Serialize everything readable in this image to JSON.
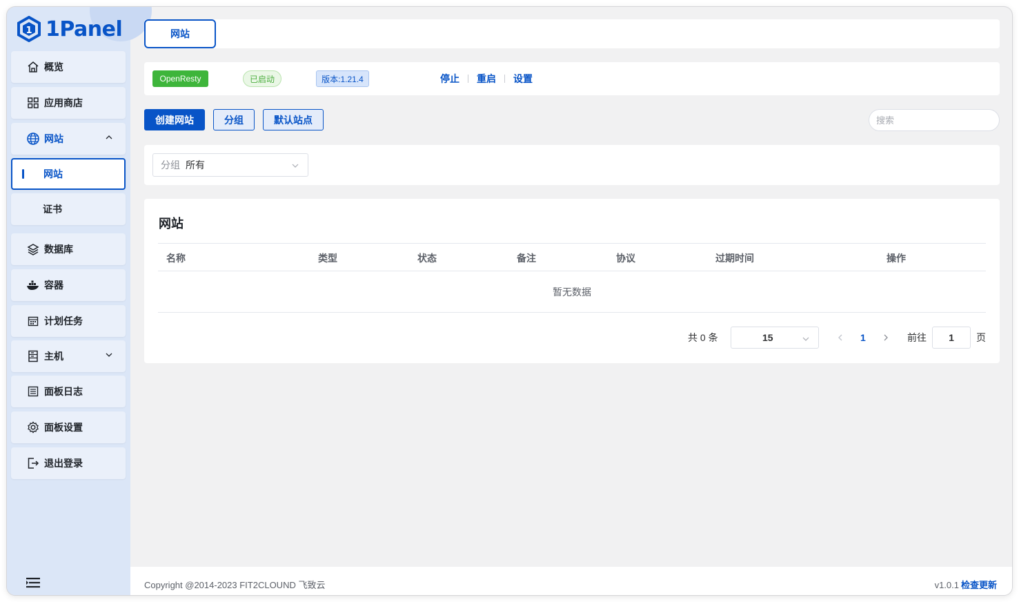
{
  "app": {
    "logo_text": "1Panel"
  },
  "sidebar": {
    "items": [
      {
        "label": "概览",
        "icon": "home-icon"
      },
      {
        "label": "应用商店",
        "icon": "grid-icon"
      },
      {
        "label": "网站",
        "icon": "globe-icon",
        "expanded": true
      },
      {
        "label": "网站",
        "active": true
      },
      {
        "label": "证书"
      },
      {
        "label": "数据库",
        "icon": "layers-icon"
      },
      {
        "label": "容器",
        "icon": "docker-icon"
      },
      {
        "label": "计划任务",
        "icon": "calendar-icon"
      },
      {
        "label": "主机",
        "icon": "server-icon"
      },
      {
        "label": "面板日志",
        "icon": "log-icon"
      },
      {
        "label": "面板设置",
        "icon": "gear-icon"
      },
      {
        "label": "退出登录",
        "icon": "logout-icon"
      }
    ]
  },
  "tabs": {
    "active": "网站"
  },
  "app_status": {
    "name": "OpenResty",
    "status": "已启动",
    "version": "版本:1.21.4",
    "actions": [
      "停止",
      "重启",
      "设置"
    ]
  },
  "toolbar": {
    "create": "创建网站",
    "group": "分组",
    "default_site": "默认站点",
    "search_placeholder": "搜索"
  },
  "filter": {
    "label": "分组",
    "value": "所有"
  },
  "table": {
    "title": "网站",
    "columns": [
      "名称",
      "类型",
      "状态",
      "备注",
      "协议",
      "过期时间",
      "操作"
    ],
    "empty_text": "暂无数据"
  },
  "pagination": {
    "total": "共 0 条",
    "page_size": "15",
    "current_page": "1",
    "goto_label": "前往",
    "goto_value": "1",
    "unit": "页"
  },
  "footer": {
    "copyright": "Copyright @2014-2023 FIT2CLOUND 飞致云",
    "version": "v1.0.1",
    "check_update": "检查更新"
  },
  "colors": {
    "primary": "#0854c7",
    "sidebar_bg": "#dbe6f7",
    "success": "#3eb53b"
  }
}
